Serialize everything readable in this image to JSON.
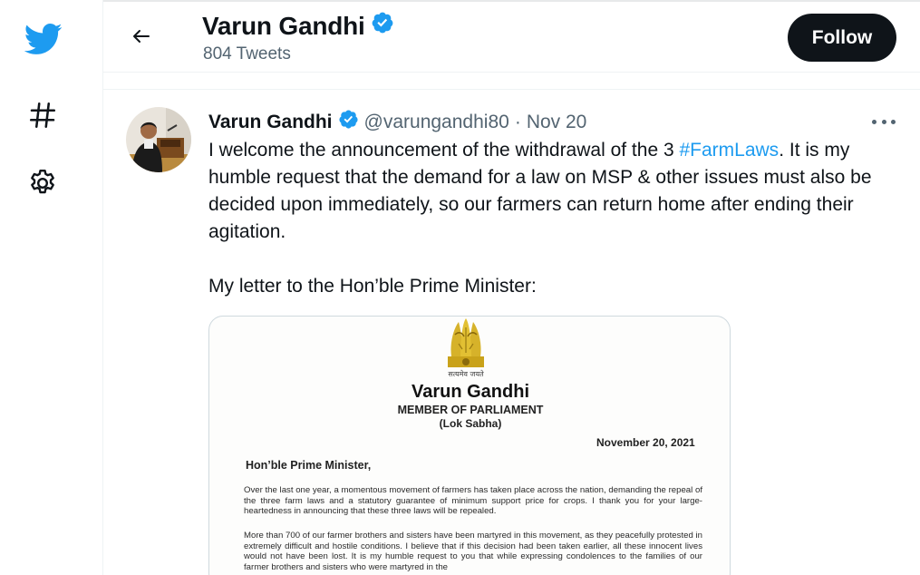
{
  "nav": {
    "items": [
      {
        "icon": "twitter-bird-icon"
      },
      {
        "icon": "hashtag-icon"
      },
      {
        "icon": "gear-icon"
      }
    ]
  },
  "colors": {
    "accent": "#1d9bf0",
    "text_primary": "#0f1419",
    "text_secondary": "#536471",
    "follow_bg": "#0f1419"
  },
  "header": {
    "name": "Varun Gandhi",
    "tweet_count": "804 Tweets",
    "follow_label": "Follow"
  },
  "tweet": {
    "author_name": "Varun Gandhi",
    "handle": "@varungandhi80",
    "separator": "·",
    "date": "Nov 20",
    "text_before_hashtag": "I welcome the announcement of the withdrawal of the 3 ",
    "hashtag": "#FarmLaws",
    "text_after_hashtag": ". It is my humble request that the demand for a law on MSP & other issues must also be decided upon immediately, so our farmers can return home after ending their agitation.",
    "text_second_paragraph": "My letter to the Hon’ble Prime Minister:",
    "media": {
      "emblem_caption": "सत्यमेव जयते",
      "letter_name": "Varun Gandhi",
      "letter_title": "MEMBER OF PARLIAMENT",
      "letter_house": "(Lok Sabha)",
      "letter_date": "November 20, 2021",
      "letter_salutation": "Hon’ble Prime Minister,",
      "letter_para1": "Over the last one year, a momentous movement of farmers has taken place across the nation, demanding the repeal of the three farm laws and a statutory guarantee of minimum support price for crops. I thank you for your large-heartedness in announcing that these three laws will be repealed.",
      "letter_para2": "More than 700 of our farmer brothers and sisters have been martyred in this movement, as they peacefully protested in extremely difficult and hostile conditions. I believe that if this decision had been taken earlier, all these innocent lives would not have been lost. It is my humble request to you that while expressing condolences to the families of our farmer brothers and sisters who were martyred in the"
    }
  }
}
